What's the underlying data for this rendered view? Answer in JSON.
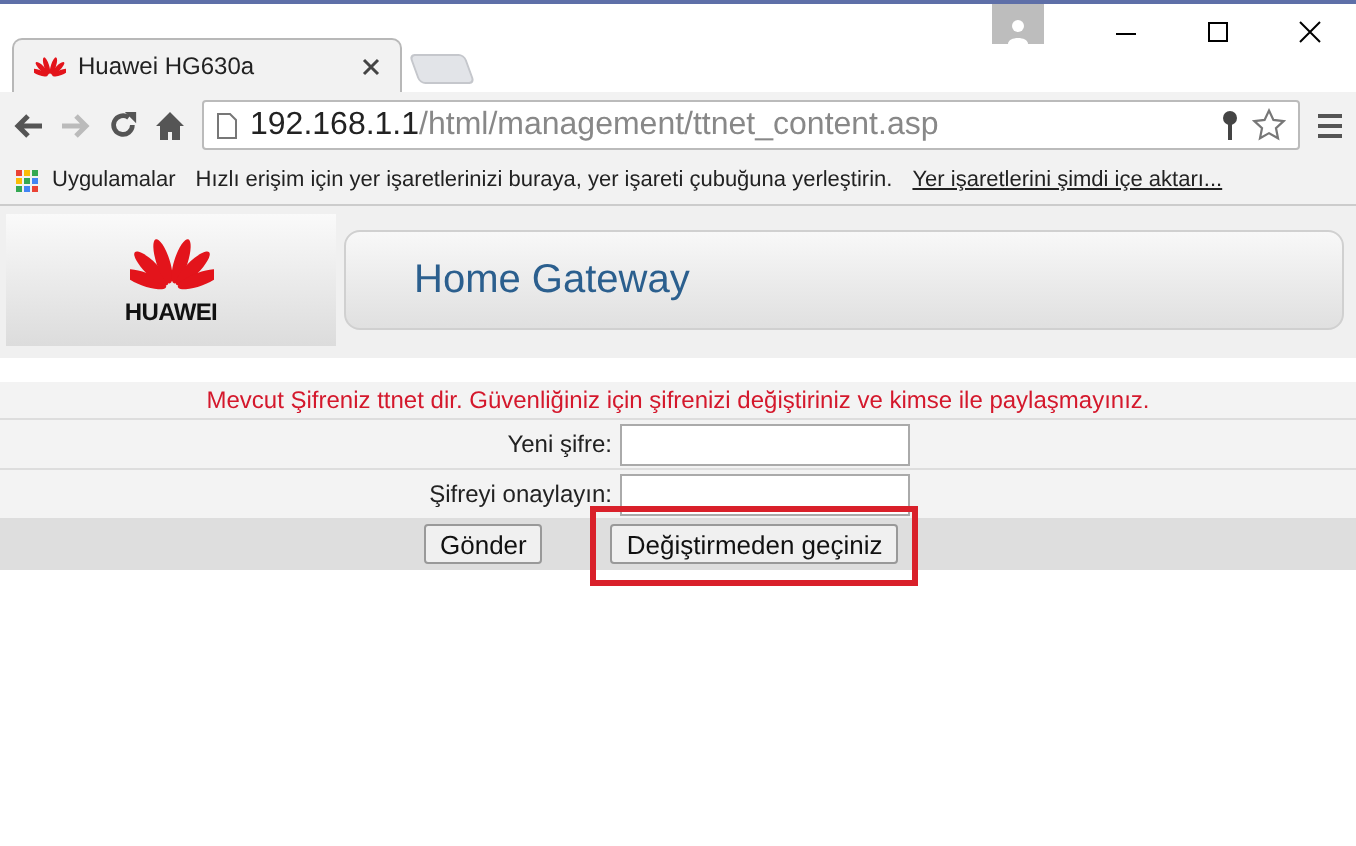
{
  "tabs": [
    {
      "title": "Huawei HG630a",
      "selected": true
    }
  ],
  "address": {
    "host": "192.168.1.1",
    "path": "/html/management/ttnet_content.asp"
  },
  "bookmarks_bar": {
    "apps": "Uygulamalar",
    "hint": "Hızlı erişim için yer işaretlerinizi buraya, yer işareti çubuğuna yerleştirin.",
    "import_link": "Yer işaretlerini şimdi içe aktarı..."
  },
  "page": {
    "logo_text": "HUAWEI",
    "title": "Home Gateway",
    "warning": "Mevcut Şifreniz ttnet dir. Güvenliğiniz için şifrenizi değiştiriniz ve kimse ile paylaşmayınız.",
    "fields": [
      {
        "label": "Yeni şifre:"
      },
      {
        "label": "Şifreyi onaylayın:"
      }
    ],
    "buttons": [
      {
        "label": "Gönder",
        "highlighted": false
      },
      {
        "label": "Değiştirmeden geçiniz",
        "highlighted": true
      }
    ]
  }
}
